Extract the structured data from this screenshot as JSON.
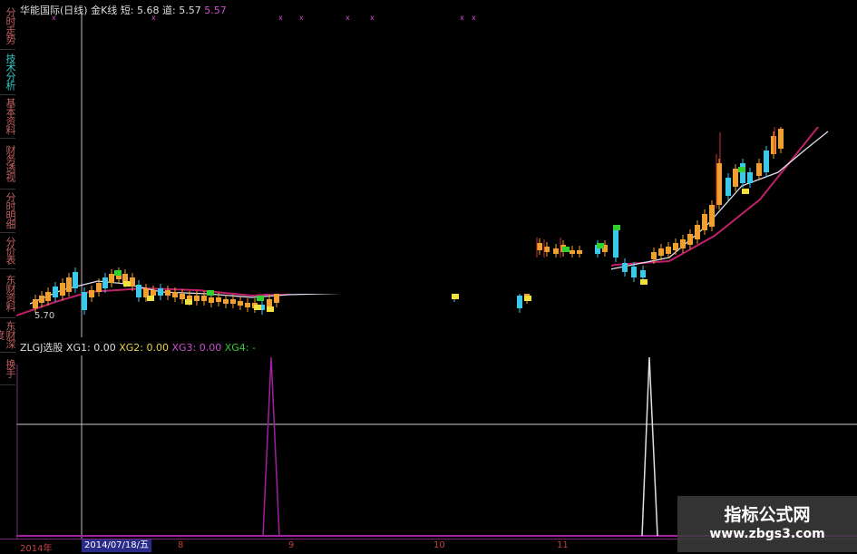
{
  "side_tabs": [
    {
      "label": "分时走势",
      "active": false
    },
    {
      "label": "技术分析",
      "active": true
    },
    {
      "label": "基本资料",
      "active": false
    },
    {
      "label": "财务透视",
      "active": false
    },
    {
      "label": "分时明细",
      "active": false
    },
    {
      "label": "分价表",
      "active": false
    },
    {
      "label": "东财资料",
      "active": false
    },
    {
      "label": "东财深度",
      "active": false
    },
    {
      "label": "换手",
      "active": false
    }
  ],
  "price_header": {
    "stock": "华能国际(日线)",
    "indicator": "金K线",
    "short_label": "短:",
    "short_value": "5.68",
    "dao_label": "道:",
    "dao_value": "5.57",
    "third_value": "5.57"
  },
  "low_label": "5.70",
  "indicator_header": {
    "name": "ZLGJ选股",
    "xg1_label": "XG1:",
    "xg1_value": "0.00",
    "xg2_label": "XG2:",
    "xg2_value": "0.00",
    "xg3_label": "XG3:",
    "xg3_value": "0.00",
    "xg4_label": "XG4:",
    "xg4_value": "-"
  },
  "time_axis": {
    "start": "2014年",
    "cursor_date": "2014/07/18/五",
    "ticks": [
      "8",
      "9",
      "10",
      "11"
    ]
  },
  "watermark": {
    "title": "指标公式网",
    "url": "www.zbgs3.com"
  },
  "colors": {
    "up": "#f0a030",
    "down": "#3cc8e8",
    "signal_yellow": "#f0e040",
    "signal_green": "#30d030",
    "ma_long": "#c0206a",
    "ma_short": "#e0e0f0",
    "xg3_signal": "#a020a0",
    "xg_white": "#e0e0e0"
  }
}
